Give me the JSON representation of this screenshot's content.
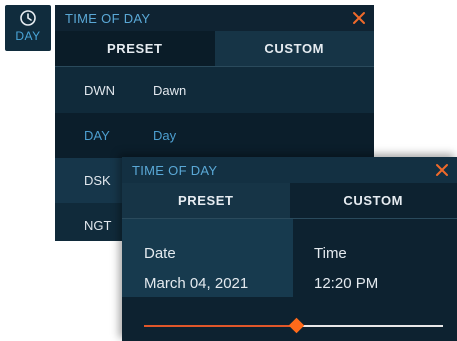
{
  "day_widget": {
    "label": "DAY",
    "icon": "clock-icon"
  },
  "preset_panel": {
    "title": "TIME OF DAY",
    "tabs": [
      {
        "label": "PRESET",
        "active": true
      },
      {
        "label": "CUSTOM",
        "active": false
      }
    ],
    "presets": [
      {
        "code": "DWN",
        "name": "Dawn"
      },
      {
        "code": "DAY",
        "name": "Day",
        "selected": true
      },
      {
        "code": "DSK",
        "name": ""
      },
      {
        "code": "NGT",
        "name": ""
      }
    ]
  },
  "custom_panel": {
    "title": "TIME OF DAY",
    "tabs": [
      {
        "label": "PRESET",
        "active": false
      },
      {
        "label": "CUSTOM",
        "active": true
      }
    ],
    "date_label": "Date",
    "date_value": "March 04, 2021",
    "time_label": "Time",
    "time_value": "12:20 PM",
    "time_slider_fraction": 0.51
  },
  "colors": {
    "accent": "#ff6a1a",
    "title_blue": "#5aa8d6",
    "panel_bg": "#102a3a"
  }
}
